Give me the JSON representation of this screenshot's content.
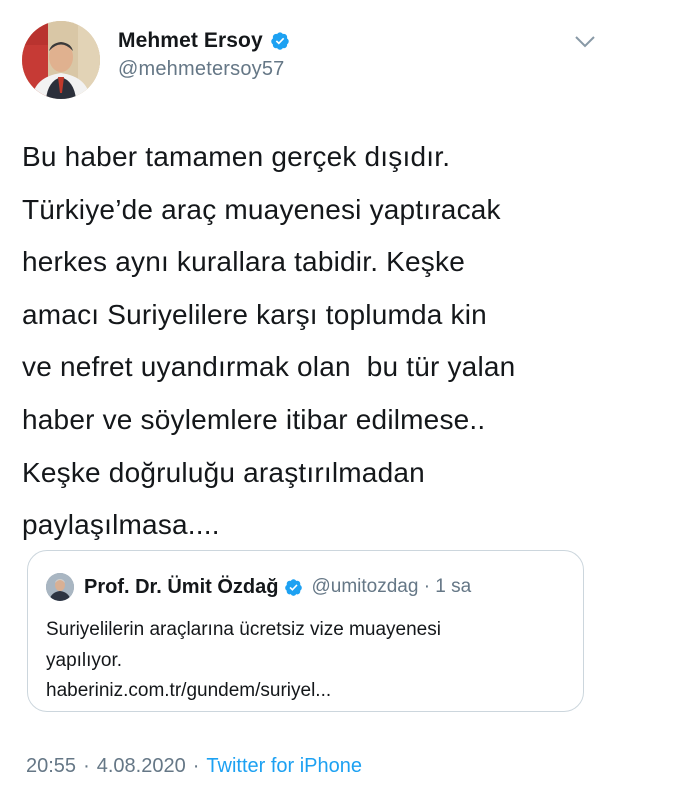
{
  "author": {
    "name": "Mehmet Ersoy",
    "handle": "@mehmetersoy57"
  },
  "tweet": {
    "lines": [
      "Bu haber tamamen gerçek dışıdır.",
      "Türkiye’de araç muayenesi yaptıracak",
      "herkes aynı kurallara tabidir. Keşke",
      "amacı Suriyelilere karşı toplumda kin",
      "ve nefret uyandırmak olan  bu tür yalan",
      "haber ve söylemlere itibar edilmese..",
      "Keşke doğruluğu araştırılmadan",
      "paylaşılmasa...."
    ]
  },
  "quoted": {
    "name": "Prof. Dr. Ümit Özdağ",
    "handle_time": "@umitozdag · 1 sa",
    "lines": [
      "Suriyelilerin araçlarına ücretsiz vize muayenesi",
      "yapılıyor.",
      "haberiniz.com.tr/gundem/suriyel..."
    ]
  },
  "meta": {
    "time": "20:55",
    "sep1": "·",
    "date": "4.08.2020",
    "sep2": "·",
    "source": "Twitter for iPhone"
  },
  "colors": {
    "verified": "#1da1f2",
    "secondary_text": "#657786",
    "link": "#1da1f2",
    "border": "#ccd6dd"
  },
  "icons": {
    "verified": "verified-badge-icon",
    "menu": "chevron-down-icon"
  }
}
